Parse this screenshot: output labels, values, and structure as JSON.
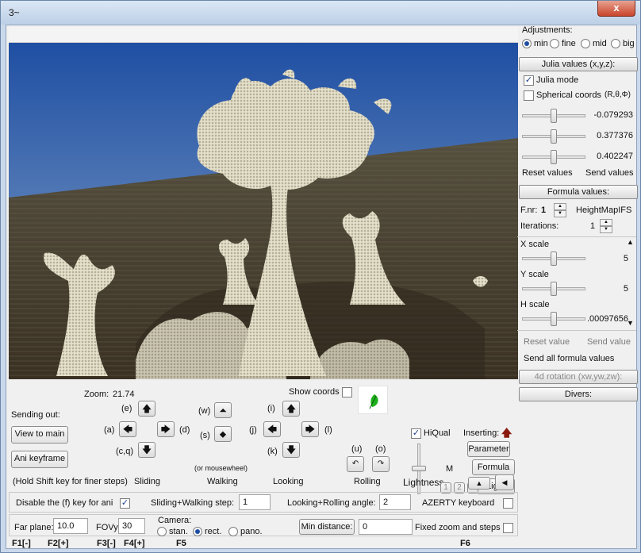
{
  "window": {
    "title": "3~",
    "close_label": "x"
  },
  "top_bar": {
    "text": ""
  },
  "adjustments": {
    "label": "Adjustments:",
    "options": [
      "min",
      "fine",
      "mid",
      "big"
    ],
    "selected": "min"
  },
  "julia": {
    "header": "Julia values (x,y,z):",
    "julia_mode_label": "Julia mode",
    "julia_mode": true,
    "spherical_label": "Spherical coords",
    "spherical_symbols": "(R,θ,Φ)",
    "spherical": false,
    "values": [
      "-0.079293",
      "0.377376",
      "0.402247"
    ],
    "slider_positions": [
      0.5,
      0.5,
      0.5
    ],
    "reset_label": "Reset values",
    "send_label": "Send values"
  },
  "formula": {
    "header": "Formula values:",
    "fnr_label": "F.nr:",
    "fnr_value": "1",
    "formula_name": "HeightMapIFS",
    "iterations_label": "Iterations:",
    "iterations_value": "1",
    "params": [
      {
        "label": "X scale",
        "value": "5",
        "position": 0.5
      },
      {
        "label": "Y scale",
        "value": "5",
        "position": 0.5
      },
      {
        "label": "H scale",
        "value": ".00097656",
        "position": 0.5
      }
    ],
    "reset_label": "Reset value",
    "send_label": "Send value",
    "send_all_label": "Send all formula values"
  },
  "rotation_header": "4d rotation (xw,yw,zw):",
  "divers_header": "Divers:",
  "navigation": {
    "sending_out_label": "Sending out:",
    "view_to_main_label": "View to main",
    "ani_keyframe_label": "Ani keyframe",
    "shift_hint": "(Hold Shift key for finer steps)",
    "zoom_label": "Zoom:",
    "zoom_value": "21.74",
    "sliding": {
      "label": "Sliding",
      "up": "(e)",
      "left": "(a)",
      "right": "(d)",
      "down": "(c,q)"
    },
    "walking": {
      "label": "Walking",
      "up": "(w)",
      "down": "(s)",
      "hint": "(or mousewheel)"
    },
    "looking": {
      "label": "Looking",
      "up": "(i)",
      "left": "(j)",
      "right": "(l)",
      "down": "(k)"
    },
    "show_coords_label": "Show coords",
    "show_coords": false,
    "rolling": {
      "label": "Rolling",
      "left": "(u)",
      "right": "(o)"
    },
    "hiqual_label": "HiQual",
    "hiqual": true,
    "lightness_label": "Lightness",
    "lightness_mark": "M",
    "lightness_level": 0.5,
    "inserting_label": "Inserting:",
    "parameter_label": "Parameter",
    "formula_label": "Formula",
    "light_label": "Light",
    "light_slots": [
      "1",
      "2",
      "3"
    ]
  },
  "bottom": {
    "disable_f_label": "Disable the (f) key for ani",
    "disable_f": true,
    "step_label": "Sliding+Walking step:",
    "step_value": "1",
    "angle_label": "Looking+Rolling angle:",
    "angle_value": "2",
    "azerty_label": "AZERTY keyboard",
    "azerty": false,
    "far_plane_label": "Far plane:",
    "far_plane_value": "10.0",
    "fovy_label": "FOVy:",
    "fovy_value": "30",
    "camera_label": "Camera:",
    "camera_options": [
      "stan.",
      "rect.",
      "pano."
    ],
    "camera_selected": "rect.",
    "min_distance_label": "Min distance:",
    "min_distance_value": "0",
    "fixed_zoom_label": "Fixed zoom and steps",
    "fixed_zoom": false,
    "fkeys": [
      "F1[-]",
      "F2[+]",
      "F3[-]",
      "F4[+]",
      "F5",
      "F6"
    ]
  },
  "colors": {
    "sky_top": "#1f4fa3",
    "sky_bottom": "#8aa6c9",
    "ground": "#3a3123",
    "fractal_light": "#ddd8c2",
    "fractal_dark": "#6a624f",
    "insert_arrow": "#8b1a0e"
  }
}
